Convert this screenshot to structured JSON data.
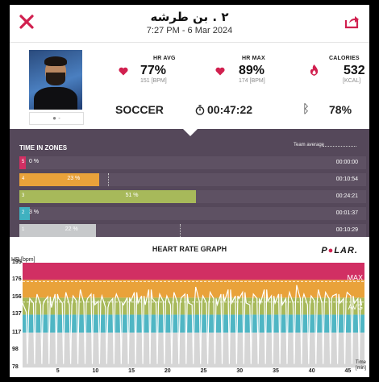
{
  "header": {
    "title": "٢ . بن طرشه",
    "datetime": "7:27 PM - 6 Mar 2024"
  },
  "summary": {
    "player_name": "-",
    "hr_avg": {
      "label": "HR AVG",
      "value": "77%",
      "sub": "151 [BPM]"
    },
    "hr_max": {
      "label": "HR MAX",
      "value": "89%",
      "sub": "174 [BPM]"
    },
    "calories": {
      "label": "CALORIES",
      "value": "532",
      "sub": "[KCAL]"
    },
    "sport": "SOCCER",
    "duration": "00:47:22",
    "battery": "78%"
  },
  "zones": {
    "title": "TIME IN ZONES",
    "team_average_label": "Team average",
    "rows": [
      {
        "zone": "5",
        "pct_label": "0 %",
        "pct": 0,
        "time": "00:00:00",
        "color": "#d12f63"
      },
      {
        "zone": "4",
        "pct_label": "23 %",
        "pct": 23,
        "time": "00:10:54",
        "color": "#e9a23a"
      },
      {
        "zone": "3",
        "pct_label": "51 %",
        "pct": 51,
        "time": "00:24:21",
        "color": "#a7b95a"
      },
      {
        "zone": "2",
        "pct_label": "3 %",
        "pct": 3,
        "time": "00:01:37",
        "color": "#3fb1c0"
      },
      {
        "zone": "1",
        "pct_label": "22 %",
        "pct": 22,
        "time": "00:10:29",
        "color": "#c7c9cb"
      }
    ]
  },
  "graph": {
    "title": "HEART RATE GRAPH",
    "brand": "POLAR",
    "y_unit": "HR [bpm]",
    "max_label": "MAX",
    "avg_label": "AVG",
    "time_label": "Time",
    "time_unit": "[min]"
  },
  "chart_data": {
    "type": "line",
    "title": "HEART RATE GRAPH",
    "xlabel": "Time [min]",
    "ylabel": "HR [bpm]",
    "x_ticks": [
      5,
      10,
      15,
      20,
      25,
      30,
      35,
      40,
      45
    ],
    "y_ticks": [
      78,
      98,
      117,
      137,
      156,
      176,
      195
    ],
    "xlim": [
      0,
      47.4
    ],
    "ylim": [
      78,
      195
    ],
    "zone_colors": [
      "#d6d6d6",
      "#4fb6c4",
      "#a7b95a",
      "#e9a23a",
      "#d12f63"
    ],
    "max_value": 174,
    "avg_value": 151,
    "series": [
      {
        "x": [
          0,
          0.5,
          1,
          1.5,
          2,
          2.5,
          3,
          3.5,
          4,
          4.5,
          5,
          5.5,
          6,
          6.5,
          7,
          7.5,
          8,
          8.5,
          9,
          9.5,
          10,
          10.5,
          11,
          11.5,
          12,
          12.5,
          13,
          13.5,
          14,
          14.5,
          15,
          15.5,
          16,
          16.5,
          17,
          17.5,
          18,
          18.5,
          19,
          19.5,
          20,
          20.5,
          21,
          21.5,
          22,
          22.5,
          23,
          23.5,
          24,
          24.5,
          25,
          25.5,
          26,
          26.5,
          27,
          27.5,
          28,
          28.5,
          29,
          29.5,
          30,
          30.5,
          31,
          31.5,
          32,
          32.5,
          33,
          33.5,
          34,
          34.5,
          35,
          35.5,
          36,
          36.5,
          37,
          37.5,
          38,
          38.5,
          39,
          39.5,
          40,
          40.5,
          41,
          41.5,
          42,
          42.5,
          43,
          43.5,
          44,
          44.5,
          45,
          45.5,
          46,
          46.5,
          47
        ],
        "values": [
          150,
          140,
          155,
          150,
          160,
          148,
          152,
          157,
          145,
          160,
          155,
          150,
          162,
          148,
          158,
          152,
          165,
          150,
          155,
          160,
          148,
          152,
          158,
          145,
          150,
          155,
          160,
          150,
          148,
          156,
          152,
          162,
          150,
          158,
          148,
          165,
          155,
          150,
          160,
          152,
          158,
          148,
          162,
          150,
          156,
          160,
          150,
          148,
          168,
          152,
          158,
          150,
          162,
          155,
          148,
          160,
          152,
          165,
          150,
          158,
          155,
          162,
          150,
          148,
          160,
          155,
          150,
          165,
          152,
          158,
          150,
          160,
          148,
          155,
          162,
          150,
          170,
          155,
          160,
          148,
          158,
          152,
          165,
          150,
          162,
          155,
          158,
          160,
          150,
          155,
          162,
          158,
          150,
          155,
          148
        ]
      }
    ]
  }
}
